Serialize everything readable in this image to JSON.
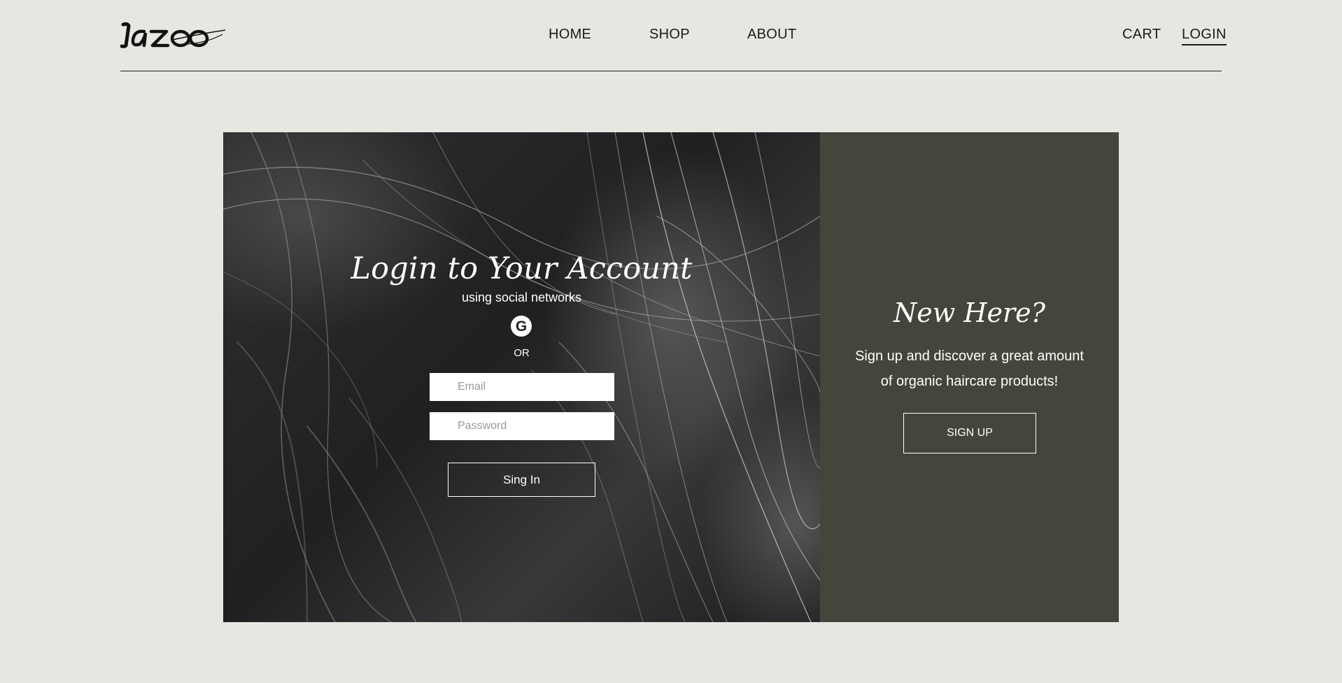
{
  "header": {
    "logo_text": "lazeo",
    "nav": {
      "home": "HOME",
      "shop": "SHOP",
      "about": "ABOUT",
      "cart": "CART",
      "login": "LOGIN"
    }
  },
  "login": {
    "title": "Login to Your Account",
    "subtitle": "using social networks",
    "google_glyph": "G",
    "or_text": "OR",
    "email_placeholder": "Email",
    "password_placeholder": "Password",
    "signin_label": "Sing In"
  },
  "signup_panel": {
    "title": "New Here?",
    "text": "Sign up and discover a great amount of organic haircare products!",
    "signup_label": "SIGN UP"
  },
  "colors": {
    "page_bg": "#e8e6e1",
    "panel_bg": "#43463a",
    "text_dark": "#1a1a1a",
    "white": "#ffffff"
  },
  "icons": {
    "social": "google-icon"
  }
}
